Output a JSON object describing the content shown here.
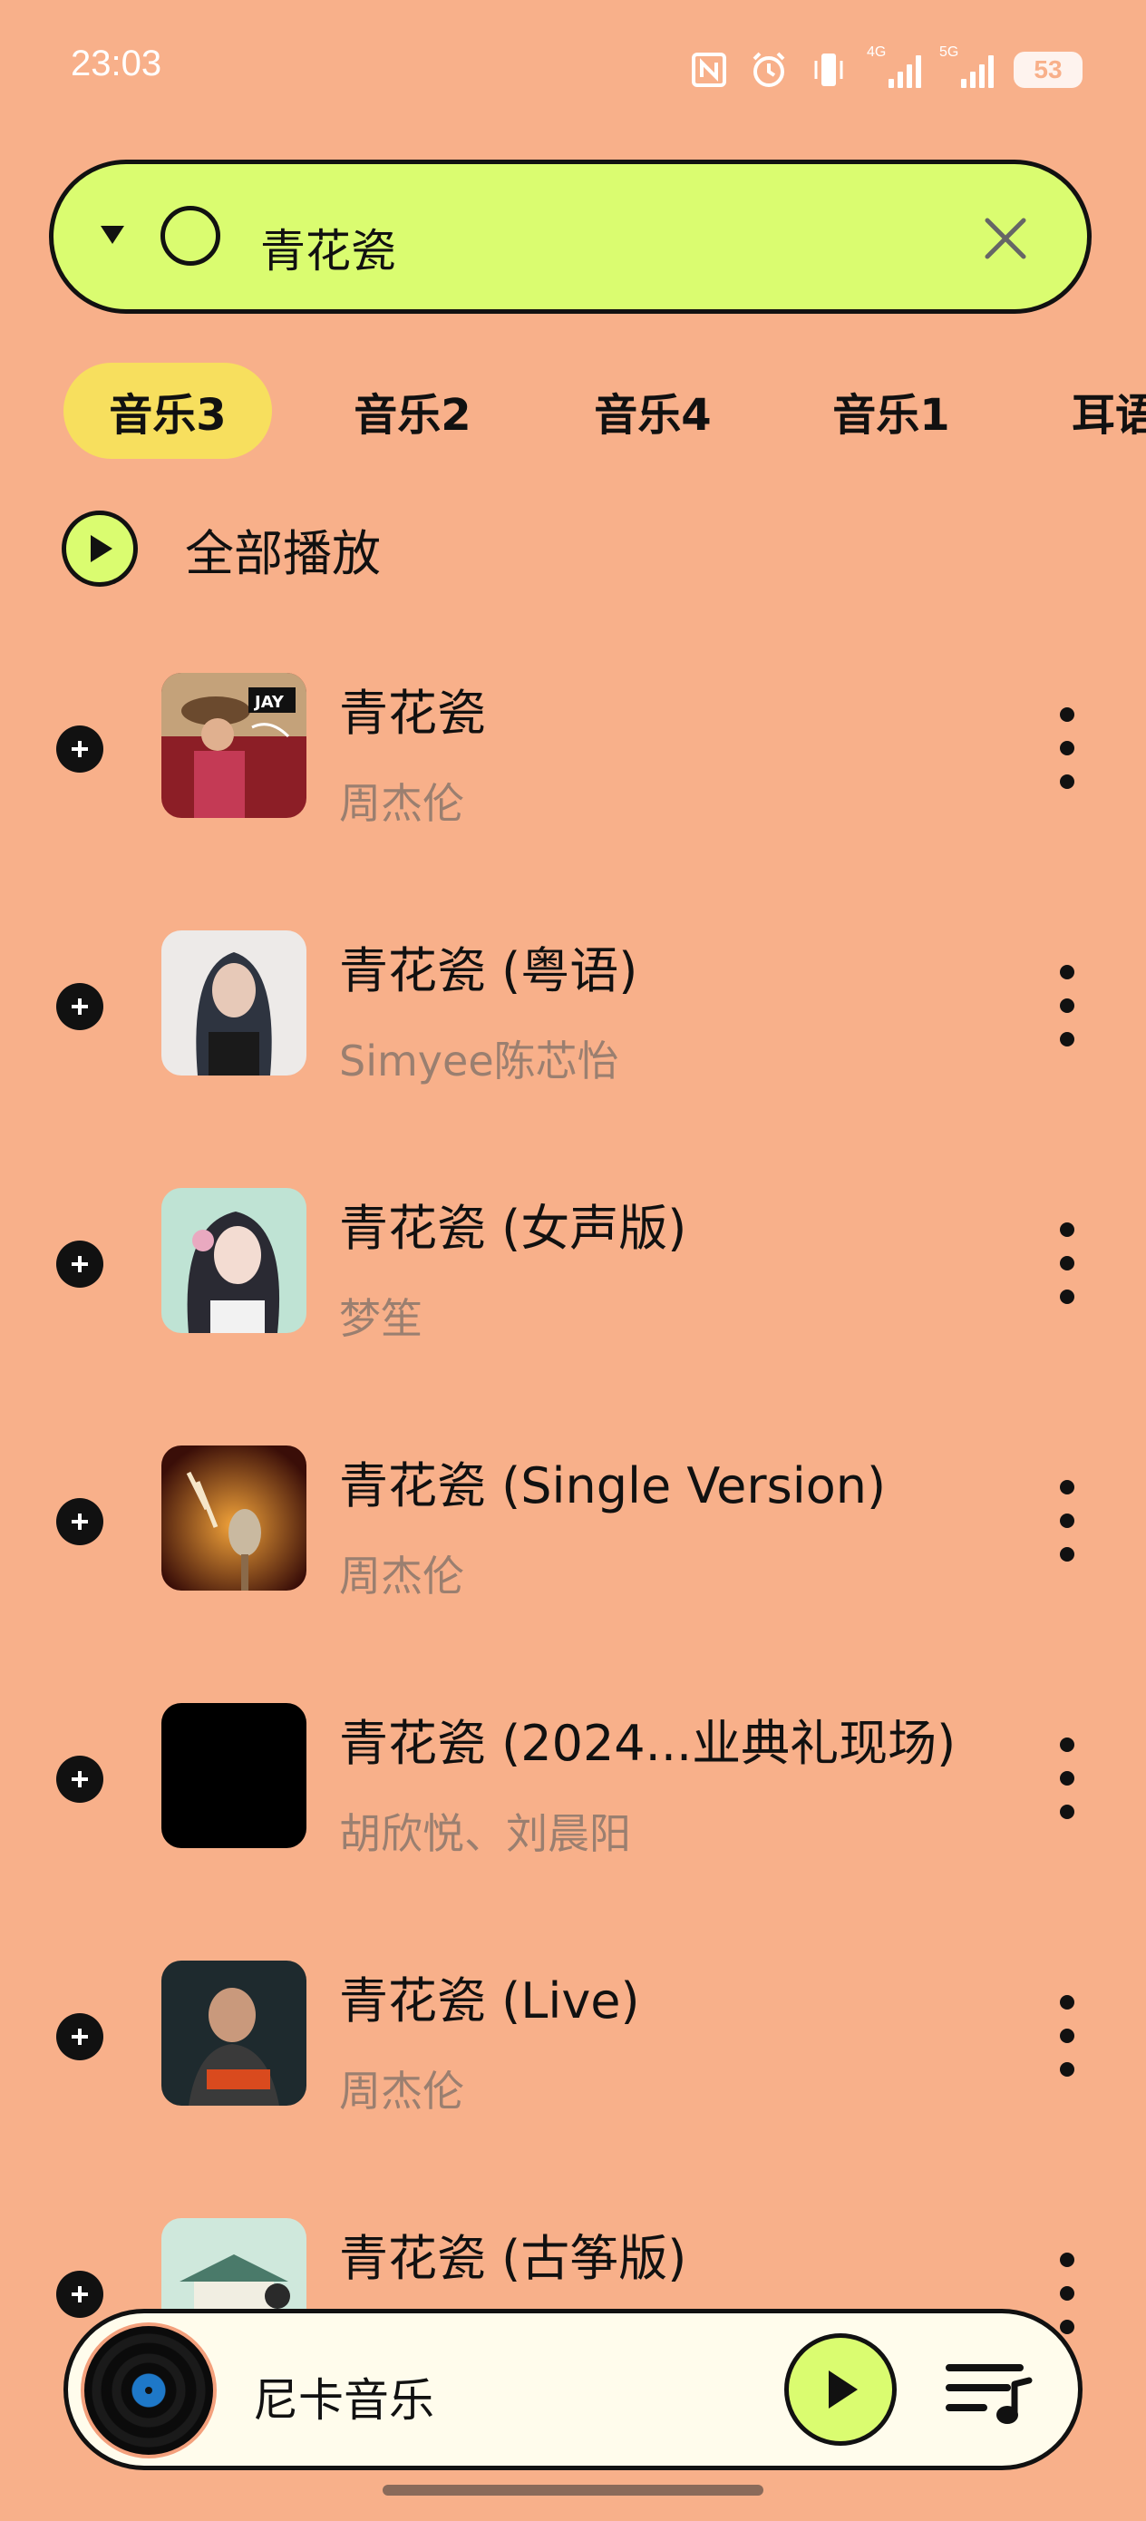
{
  "status_bar": {
    "time": "23:03",
    "battery": "53",
    "network_1": "4G",
    "network_2": "5G",
    "icons": [
      "nfc-icon",
      "alarm-icon",
      "vibrate-icon",
      "signal-4g-icon",
      "signal-5g-icon",
      "battery-icon"
    ]
  },
  "search": {
    "query": "青花瓷"
  },
  "tabs": [
    {
      "label": "音乐3",
      "active": true
    },
    {
      "label": "音乐2",
      "active": false
    },
    {
      "label": "音乐4",
      "active": false
    },
    {
      "label": "音乐1",
      "active": false
    },
    {
      "label": "耳语",
      "active": false
    }
  ],
  "play_all": {
    "label": "全部播放"
  },
  "songs": [
    {
      "title": "青花瓷",
      "artist": "周杰伦",
      "cover": "album-jay"
    },
    {
      "title": "青花瓷 (粤语)",
      "artist": "Simyee陈芯怡",
      "cover": "portrait-woman"
    },
    {
      "title": "青花瓷 (女声版)",
      "artist": "梦笙",
      "cover": "illustrated-woman"
    },
    {
      "title": "青花瓷 (Single Version)",
      "artist": "周杰伦",
      "cover": "album-red-stage"
    },
    {
      "title": "青花瓷 (2024...业典礼现场)",
      "artist": "胡欣悦、刘晨阳",
      "cover": "black"
    },
    {
      "title": "青花瓷 (Live)",
      "artist": "周杰伦",
      "cover": "album-live"
    },
    {
      "title": "青花瓷 (古筝版)",
      "artist": "",
      "cover": "album-guzheng"
    }
  ],
  "player": {
    "name": "尼卡音乐"
  },
  "colors": {
    "background": "#F8B08A",
    "accent_green": "#DAFC70",
    "tab_active": "#F7DF5E",
    "artist_text": "#9A7F70"
  }
}
